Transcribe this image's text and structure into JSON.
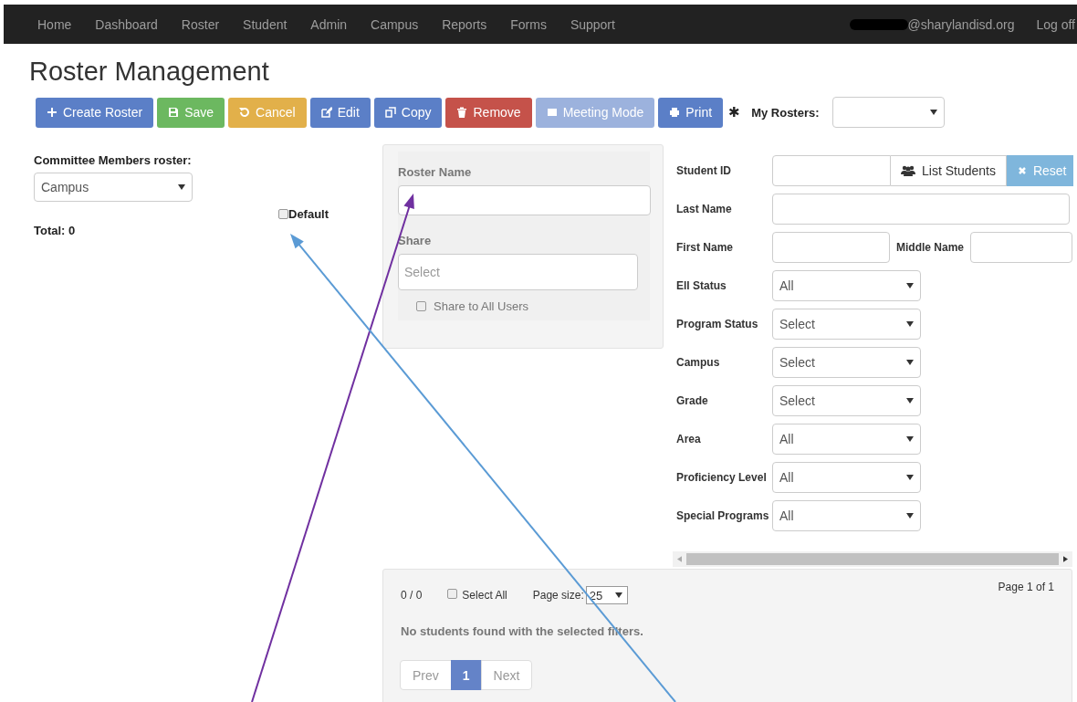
{
  "nav": {
    "items": [
      "Home",
      "Dashboard",
      "Roster",
      "Student",
      "Admin",
      "Campus",
      "Reports",
      "Forms",
      "Support"
    ],
    "user_email": "@sharylandisd.org",
    "logout": "Log off"
  },
  "page_title": "Roster Management",
  "toolbar": [
    {
      "kind": "create",
      "label": "Create Roster",
      "disabled": false
    },
    {
      "kind": "save",
      "label": "Save",
      "disabled": false
    },
    {
      "kind": "cancel",
      "label": "Cancel",
      "disabled": false
    },
    {
      "kind": "edit",
      "label": "Edit",
      "disabled": false
    },
    {
      "kind": "copy",
      "label": "Copy",
      "disabled": false
    },
    {
      "kind": "remove",
      "label": "Remove",
      "disabled": false
    },
    {
      "kind": "meeting",
      "label": "Meeting Mode",
      "disabled": true
    },
    {
      "kind": "print",
      "label": "Print",
      "disabled": false
    }
  ],
  "my_rosters": {
    "marker": "✱",
    "label": "My Rosters:"
  },
  "committee": {
    "label": "Committee Members roster:",
    "value": "Campus",
    "default_checkbox": {
      "label": "Default",
      "checked": false
    },
    "total": "Total: 0"
  },
  "roster_panel": {
    "name_label": "Roster Name",
    "share_label": "Share",
    "share_placeholder": "Select",
    "share_all": {
      "label": "Share to All Users",
      "checked": false
    }
  },
  "filters": {
    "student_id": "Student ID",
    "list_students": "List Students",
    "reset": "Reset",
    "last_name": "Last Name",
    "first_name": "First Name",
    "middle_name": "Middle Name",
    "selects": [
      {
        "label": "Ell Status",
        "value": "All"
      },
      {
        "label": "Program Status",
        "value": "Select"
      },
      {
        "label": "Campus",
        "value": "Select"
      },
      {
        "label": "Grade",
        "value": "Select"
      },
      {
        "label": "Area",
        "value": "All"
      },
      {
        "label": "Proficiency Level",
        "value": "All"
      },
      {
        "label": "Special Programs",
        "value": "All"
      }
    ]
  },
  "results": {
    "count": "0 / 0",
    "select_all": {
      "label": "Select All",
      "checked": false
    },
    "page_size_label": "Page size:",
    "page_size": "25",
    "page_info": "Page 1 of 1",
    "message": "No students found with the selected filters.",
    "pagination": [
      {
        "label": "Prev",
        "selected": false
      },
      {
        "label": "1",
        "selected": true
      },
      {
        "label": "Next",
        "selected": false
      }
    ]
  },
  "annotations": [
    {
      "kind": "arrow",
      "color": "#7030a0"
    },
    {
      "kind": "arrow",
      "color": "#5b9bd5"
    }
  ]
}
